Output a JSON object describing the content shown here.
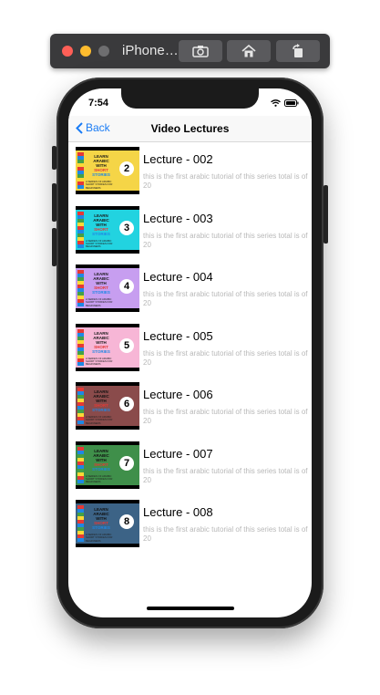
{
  "simulator": {
    "title": "iPhone…",
    "buttons": [
      "screenshot-icon",
      "home-icon",
      "rotate-icon"
    ]
  },
  "status_bar": {
    "time": "7:54",
    "icons": [
      "wifi-icon",
      "battery-icon"
    ]
  },
  "nav": {
    "back_label": "Back",
    "title": "Video Lectures"
  },
  "thumbnail": {
    "line1": "LEARN ARABIC",
    "line2": "WITH",
    "line3": "SHORT",
    "line4": "STORIES",
    "sub": "A SERIES OF ARABIC SHORT STORIES FOR BEGINNERS"
  },
  "lectures": [
    {
      "title": "Lecture - 002",
      "number": "2",
      "description": "this is the first arabic tutorial of this series total is of 20",
      "bg": "#f5d547"
    },
    {
      "title": "Lecture - 003",
      "number": "3",
      "description": "this is the first arabic tutorial of this series total is of 20",
      "bg": "#22d3e0"
    },
    {
      "title": "Lecture - 004",
      "number": "4",
      "description": "this is the first arabic tutorial of this series total is of 20",
      "bg": "#c79ef0"
    },
    {
      "title": "Lecture - 005",
      "number": "5",
      "description": "this is the first arabic tutorial of this series total is of 20",
      "bg": "#f7b6d6"
    },
    {
      "title": "Lecture - 006",
      "number": "6",
      "description": "this is the first arabic tutorial of this series total is of 20",
      "bg": "#8a4b4b"
    },
    {
      "title": "Lecture - 007",
      "number": "7",
      "description": "this is the first arabic tutorial of this series total is of 20",
      "bg": "#3f8f4a"
    },
    {
      "title": "Lecture - 008",
      "number": "8",
      "description": "this is the first arabic tutorial of this series total is of 20",
      "bg": "#3c6386"
    }
  ],
  "colors": {
    "accent": "#1a7cf5",
    "secondary_text": "#b8b8b8"
  }
}
